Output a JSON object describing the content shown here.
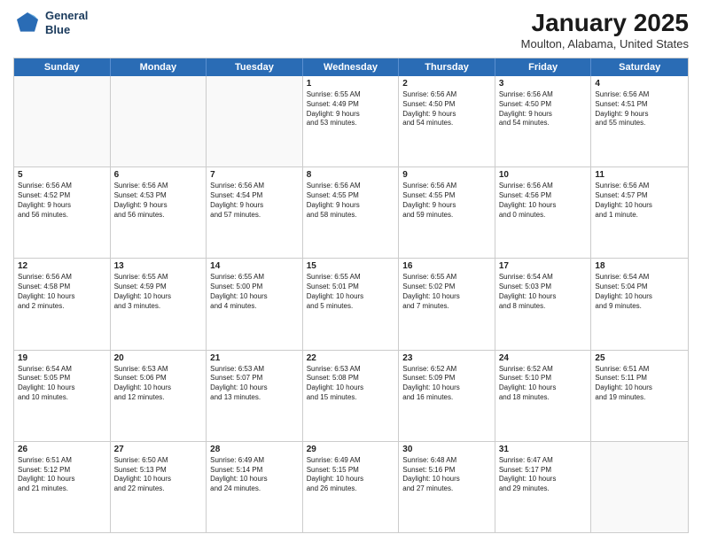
{
  "header": {
    "logo_line1": "General",
    "logo_line2": "Blue",
    "month": "January 2025",
    "location": "Moulton, Alabama, United States"
  },
  "weekdays": [
    "Sunday",
    "Monday",
    "Tuesday",
    "Wednesday",
    "Thursday",
    "Friday",
    "Saturday"
  ],
  "weeks": [
    [
      {
        "day": "",
        "info": ""
      },
      {
        "day": "",
        "info": ""
      },
      {
        "day": "",
        "info": ""
      },
      {
        "day": "1",
        "info": "Sunrise: 6:55 AM\nSunset: 4:49 PM\nDaylight: 9 hours\nand 53 minutes."
      },
      {
        "day": "2",
        "info": "Sunrise: 6:56 AM\nSunset: 4:50 PM\nDaylight: 9 hours\nand 54 minutes."
      },
      {
        "day": "3",
        "info": "Sunrise: 6:56 AM\nSunset: 4:50 PM\nDaylight: 9 hours\nand 54 minutes."
      },
      {
        "day": "4",
        "info": "Sunrise: 6:56 AM\nSunset: 4:51 PM\nDaylight: 9 hours\nand 55 minutes."
      }
    ],
    [
      {
        "day": "5",
        "info": "Sunrise: 6:56 AM\nSunset: 4:52 PM\nDaylight: 9 hours\nand 56 minutes."
      },
      {
        "day": "6",
        "info": "Sunrise: 6:56 AM\nSunset: 4:53 PM\nDaylight: 9 hours\nand 56 minutes."
      },
      {
        "day": "7",
        "info": "Sunrise: 6:56 AM\nSunset: 4:54 PM\nDaylight: 9 hours\nand 57 minutes."
      },
      {
        "day": "8",
        "info": "Sunrise: 6:56 AM\nSunset: 4:55 PM\nDaylight: 9 hours\nand 58 minutes."
      },
      {
        "day": "9",
        "info": "Sunrise: 6:56 AM\nSunset: 4:55 PM\nDaylight: 9 hours\nand 59 minutes."
      },
      {
        "day": "10",
        "info": "Sunrise: 6:56 AM\nSunset: 4:56 PM\nDaylight: 10 hours\nand 0 minutes."
      },
      {
        "day": "11",
        "info": "Sunrise: 6:56 AM\nSunset: 4:57 PM\nDaylight: 10 hours\nand 1 minute."
      }
    ],
    [
      {
        "day": "12",
        "info": "Sunrise: 6:56 AM\nSunset: 4:58 PM\nDaylight: 10 hours\nand 2 minutes."
      },
      {
        "day": "13",
        "info": "Sunrise: 6:55 AM\nSunset: 4:59 PM\nDaylight: 10 hours\nand 3 minutes."
      },
      {
        "day": "14",
        "info": "Sunrise: 6:55 AM\nSunset: 5:00 PM\nDaylight: 10 hours\nand 4 minutes."
      },
      {
        "day": "15",
        "info": "Sunrise: 6:55 AM\nSunset: 5:01 PM\nDaylight: 10 hours\nand 5 minutes."
      },
      {
        "day": "16",
        "info": "Sunrise: 6:55 AM\nSunset: 5:02 PM\nDaylight: 10 hours\nand 7 minutes."
      },
      {
        "day": "17",
        "info": "Sunrise: 6:54 AM\nSunset: 5:03 PM\nDaylight: 10 hours\nand 8 minutes."
      },
      {
        "day": "18",
        "info": "Sunrise: 6:54 AM\nSunset: 5:04 PM\nDaylight: 10 hours\nand 9 minutes."
      }
    ],
    [
      {
        "day": "19",
        "info": "Sunrise: 6:54 AM\nSunset: 5:05 PM\nDaylight: 10 hours\nand 10 minutes."
      },
      {
        "day": "20",
        "info": "Sunrise: 6:53 AM\nSunset: 5:06 PM\nDaylight: 10 hours\nand 12 minutes."
      },
      {
        "day": "21",
        "info": "Sunrise: 6:53 AM\nSunset: 5:07 PM\nDaylight: 10 hours\nand 13 minutes."
      },
      {
        "day": "22",
        "info": "Sunrise: 6:53 AM\nSunset: 5:08 PM\nDaylight: 10 hours\nand 15 minutes."
      },
      {
        "day": "23",
        "info": "Sunrise: 6:52 AM\nSunset: 5:09 PM\nDaylight: 10 hours\nand 16 minutes."
      },
      {
        "day": "24",
        "info": "Sunrise: 6:52 AM\nSunset: 5:10 PM\nDaylight: 10 hours\nand 18 minutes."
      },
      {
        "day": "25",
        "info": "Sunrise: 6:51 AM\nSunset: 5:11 PM\nDaylight: 10 hours\nand 19 minutes."
      }
    ],
    [
      {
        "day": "26",
        "info": "Sunrise: 6:51 AM\nSunset: 5:12 PM\nDaylight: 10 hours\nand 21 minutes."
      },
      {
        "day": "27",
        "info": "Sunrise: 6:50 AM\nSunset: 5:13 PM\nDaylight: 10 hours\nand 22 minutes."
      },
      {
        "day": "28",
        "info": "Sunrise: 6:49 AM\nSunset: 5:14 PM\nDaylight: 10 hours\nand 24 minutes."
      },
      {
        "day": "29",
        "info": "Sunrise: 6:49 AM\nSunset: 5:15 PM\nDaylight: 10 hours\nand 26 minutes."
      },
      {
        "day": "30",
        "info": "Sunrise: 6:48 AM\nSunset: 5:16 PM\nDaylight: 10 hours\nand 27 minutes."
      },
      {
        "day": "31",
        "info": "Sunrise: 6:47 AM\nSunset: 5:17 PM\nDaylight: 10 hours\nand 29 minutes."
      },
      {
        "day": "",
        "info": ""
      }
    ]
  ]
}
